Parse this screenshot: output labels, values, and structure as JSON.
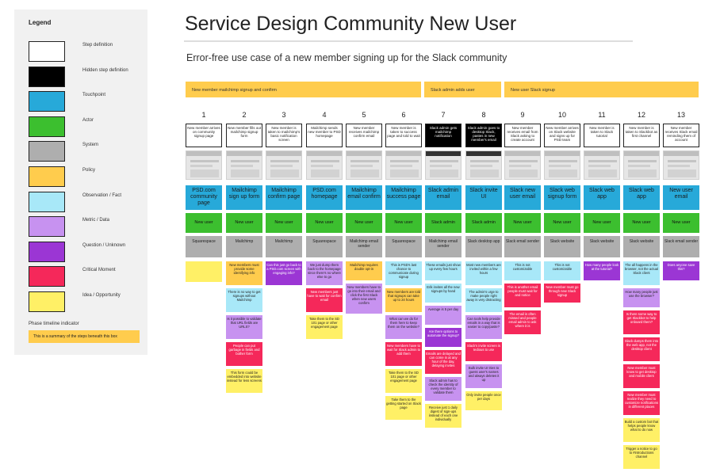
{
  "title": "Service Design Community New User",
  "subtitle": "Error-free use case of a new member signing up for the Slack community",
  "legend": {
    "title": "Legend",
    "items": [
      {
        "label": "Step definition",
        "color": "#ffffff"
      },
      {
        "label": "Hidden step definition",
        "color": "#000000"
      },
      {
        "label": "Touchpoint",
        "color": "#27a9d9"
      },
      {
        "label": "Actor",
        "color": "#3cbf2f"
      },
      {
        "label": "System",
        "color": "#aeaeae"
      },
      {
        "label": "Policy",
        "color": "#ffcc4d"
      },
      {
        "label": "Observation / Fact",
        "color": "#a8e8f8"
      },
      {
        "label": "Metric / Data",
        "color": "#c792f0"
      },
      {
        "label": "Question / Unknown",
        "color": "#9b36d4"
      },
      {
        "label": "Critical Moment",
        "color": "#f5285a"
      },
      {
        "label": "Idea / Opportunity",
        "color": "#fff066"
      }
    ],
    "phase_title": "Phase timeline indicator",
    "phase_text": "This is a summary of the steps beneath this box"
  },
  "phases": [
    {
      "label": "New member mailchimp signup and confirm"
    },
    {
      "label": "Slack admin adds user"
    },
    {
      "label": "New user Slack signup"
    }
  ],
  "note_colors": {
    "policy": "#ffcc4d",
    "observation": "#a8e8f8",
    "metric": "#c792f0",
    "question": "#9b36d4",
    "critical": "#f5285a",
    "idea": "#fff066"
  },
  "columns": [
    {
      "num": "1",
      "step": "New member arrives on community signup page",
      "hidden": false,
      "touchpoint": "PSD.com community page",
      "actor": "New user",
      "system": "Squarespace",
      "notes": [
        {
          "type": "idea",
          "text": ""
        }
      ]
    },
    {
      "num": "2",
      "step": "New member fills out mailchimp signup form",
      "hidden": false,
      "touchpoint": "Mailchimp sign up form",
      "actor": "New user",
      "system": "Mailchimp",
      "notes": [
        {
          "type": "policy",
          "text": "New members must provide some identifying info"
        },
        {
          "type": "observation",
          "text": "There is no way to get signups without Mailchimp"
        },
        {
          "type": "metric",
          "text": "Is it possible to validate that URL fields are URLS?"
        },
        {
          "type": "critical",
          "text": "People can put garbage in fields and bother form"
        },
        {
          "type": "idea",
          "text": "This form could be embedded into website instead for less screens"
        }
      ]
    },
    {
      "num": "3",
      "step": "New member is taken to mailchimp's basic notification screen",
      "hidden": false,
      "touchpoint": "Mailchimp confirm page",
      "actor": "New user",
      "system": "Mailchimp",
      "notes": [
        {
          "type": "question",
          "text": "Can this just go back to a PSD.com screen with engaging info?"
        }
      ]
    },
    {
      "num": "4",
      "step": "Mailchimp sends new member to PSD homepage",
      "hidden": false,
      "touchpoint": "PSD.com homepage",
      "actor": "New user",
      "system": "Squarespace",
      "notes": [
        {
          "type": "metric",
          "text": "We just dump them back to the homepage since there's no where else to go"
        },
        {
          "type": "critical",
          "text": "New members just have to wait for confirm email"
        },
        {
          "type": "idea",
          "text": "Take them to the SD 101 page or other engagement page"
        }
      ]
    },
    {
      "num": "5",
      "step": "New member receives mailchimp confirm email",
      "hidden": false,
      "touchpoint": "Mailchimp email confirm",
      "actor": "New user",
      "system": "Mailchimp email sender",
      "notes": [
        {
          "type": "policy",
          "text": "Mailchimp requires double opt-in"
        },
        {
          "type": "metric",
          "text": "New members have to go into their email and click the first Slack when new users confirm"
        }
      ]
    },
    {
      "num": "6",
      "step": "New member is taken to success page and told to wait",
      "hidden": false,
      "touchpoint": "Mailchimp success page",
      "actor": "New user",
      "system": "Squarespace",
      "notes": [
        {
          "type": "observation",
          "text": "This is PSD's last chance to communicate during signup"
        },
        {
          "type": "policy",
          "text": "New members are told that signups can take up to 24 hours"
        },
        {
          "type": "metric",
          "text": "What can we do for them here to keep them on the website?"
        },
        {
          "type": "critical",
          "text": "New members have to wait for Slack admin to add them"
        },
        {
          "type": "idea",
          "text": "Take them to the SD 101 page or other engagement page"
        },
        {
          "type": "idea",
          "text": "Take them to the getting started on Slack page"
        }
      ]
    },
    {
      "num": "7",
      "step": "Slack admin gets mailchimp notification",
      "hidden": true,
      "touchpoint": "Slack admin email",
      "actor": "Slack admin",
      "system": "Mailchimp email sender",
      "notes": [
        {
          "type": "observation",
          "text": "These emails just show up every few hours"
        },
        {
          "type": "observation",
          "text": "Erik invites all the new signups by hand"
        },
        {
          "type": "metric",
          "text": "Average is 5 per day"
        },
        {
          "type": "question",
          "text": "Are there options to automate the signup?"
        },
        {
          "type": "critical",
          "text": "Emails are delayed and can come in at any hour of the day, delaying invites"
        },
        {
          "type": "metric",
          "text": "Slack admin has to check the identity of every member to validate them"
        },
        {
          "type": "idea",
          "text": "Receive just 1 daily digest of sign-ups instead of each one individually"
        }
      ]
    },
    {
      "num": "8",
      "step": "Slack admin goes to desktop Slack, pastes in new member's email",
      "hidden": true,
      "touchpoint": "Slack invite UI",
      "actor": "Slack admin",
      "system": "Slack desktop app",
      "notes": [
        {
          "type": "observation",
          "text": "Most new members are invited within a few hours"
        },
        {
          "type": "observation",
          "text": "The admin's urge to make people right away is very distracting"
        },
        {
          "type": "metric",
          "text": "Can tools help provide emails in a way that is easier to copy/paste?"
        },
        {
          "type": "critical",
          "text": "Slack's invite screen is tedious to use"
        },
        {
          "type": "metric",
          "text": "Bulk invite UI tries to guess user's names and always deletes it up"
        },
        {
          "type": "idea",
          "text": "Only invite people once per days"
        }
      ]
    },
    {
      "num": "9",
      "step": "New member receives email from Slack asking to create account",
      "hidden": false,
      "touchpoint": "Slack new user email",
      "actor": "New user",
      "system": "Slack email sender",
      "notes": [
        {
          "type": "observation",
          "text": "This is not customizable"
        },
        {
          "type": "critical",
          "text": "This is another email people must wait for and notice"
        },
        {
          "type": "critical",
          "text": "The email is often missed and people email admin to ask where it is"
        }
      ]
    },
    {
      "num": "10",
      "step": "New member arrives on Slack website and signs up for PSD team",
      "hidden": false,
      "touchpoint": "Slack web signup form",
      "actor": "New user",
      "system": "Slack website",
      "notes": [
        {
          "type": "observation",
          "text": "This is not customizable"
        },
        {
          "type": "critical",
          "text": "New member must go through new Slack signup"
        }
      ]
    },
    {
      "num": "11",
      "step": "New member is taken to Slack tutorial",
      "hidden": false,
      "touchpoint": "Slack web app",
      "actor": "New user",
      "system": "Slack website",
      "notes": [
        {
          "type": "question",
          "text": "How many people look at the tutorial?"
        }
      ]
    },
    {
      "num": "12",
      "step": "New member is taken to Slackbot as first channel",
      "hidden": false,
      "touchpoint": "Slack web app",
      "actor": "New user",
      "system": "Slack website",
      "notes": [
        {
          "type": "observation",
          "text": "The all happens in the browser, not the actual Slack client"
        },
        {
          "type": "metric",
          "text": "How many people just use the browser?"
        },
        {
          "type": "critical",
          "text": "Is there some way to get Slackbot to help onboard them?"
        },
        {
          "type": "critical",
          "text": "Slack dumps them into the web app, not the desktop client"
        },
        {
          "type": "critical",
          "text": "New member must know to get desktop and mobile client"
        },
        {
          "type": "critical",
          "text": "New member must realize they need to customize notifications in different places"
        },
        {
          "type": "idea",
          "text": "Build a custom bot that helps people know what to do now"
        },
        {
          "type": "idea",
          "text": "Trigger a notice to go to #introductions channel"
        }
      ]
    },
    {
      "num": "13",
      "step": "New member receives Slack email reminding them of account",
      "hidden": false,
      "touchpoint": "New user email",
      "actor": "New user",
      "system": "Slack email sender",
      "notes": [
        {
          "type": "question",
          "text": "Does anyone save this?"
        }
      ]
    }
  ]
}
